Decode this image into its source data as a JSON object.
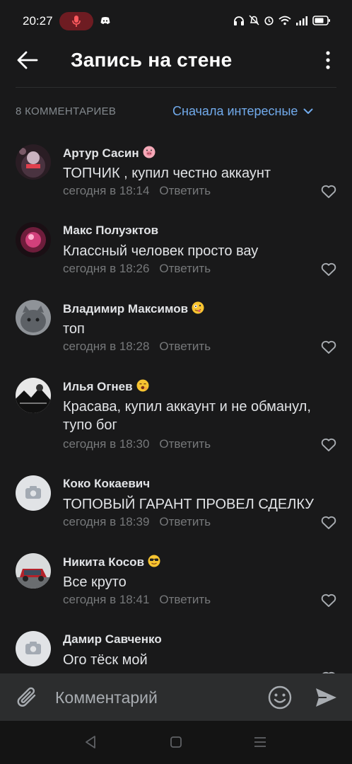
{
  "status_bar": {
    "time": "20:27",
    "icons": [
      "mic-icon",
      "discord-icon",
      "headphones-icon",
      "bell-off-icon",
      "alarm-icon",
      "wifi-icon",
      "signal-icon",
      "battery-icon"
    ]
  },
  "header": {
    "title": "Запись на стене"
  },
  "sort": {
    "count_label": "8 КОММЕНТАРИЕВ",
    "selected": "Сначала интересные"
  },
  "colors": {
    "background": "#19191a",
    "accent": "#71aaeb",
    "muted": "#76787a",
    "input_bar": "#2c2d2e"
  },
  "comments": [
    {
      "name": "Артур Сасин",
      "emoji": "pig-face-icon",
      "text": "ТОПЧИК , купил честно аккаунт",
      "time": "сегодня в 18:14",
      "reply": "Ответить"
    },
    {
      "name": "Макс Полуэктов",
      "emoji": "",
      "text": "Классный человек просто вау",
      "time": "сегодня в 18:26",
      "reply": "Ответить"
    },
    {
      "name": "Владимир Максимов",
      "emoji": "zany-face-icon",
      "text": "топ",
      "time": "сегодня в 18:28",
      "reply": "Ответить"
    },
    {
      "name": "Илья Огнев",
      "emoji": "yawning-face-icon",
      "text": "Красава, купил аккаунт и не обманул, тупо бог",
      "time": "сегодня в 18:30",
      "reply": "Ответить"
    },
    {
      "name": "Коко Кокаевич",
      "emoji": "",
      "text": "ТОПОВЫЙ ГАРАНТ ПРОВЕЛ СДЕЛКУ",
      "time": "сегодня в 18:39",
      "reply": "Ответить"
    },
    {
      "name": "Никита Косов",
      "emoji": "sunglasses-face-icon",
      "text": "Все круто",
      "time": "сегодня в 18:41",
      "reply": "Ответить"
    },
    {
      "name": "Дамир Савченко",
      "emoji": "",
      "text": "Ого тёск мой",
      "time": "",
      "reply": ""
    }
  ],
  "input": {
    "placeholder": "Комментарий"
  }
}
